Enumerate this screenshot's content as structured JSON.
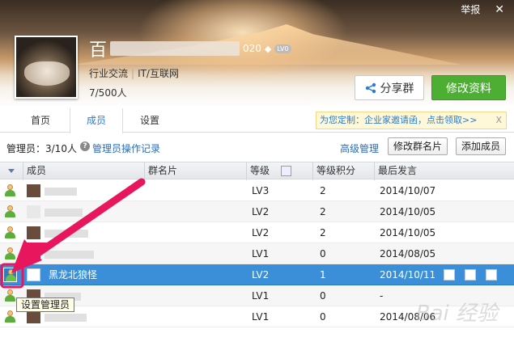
{
  "header": {
    "report_label": "举报",
    "close_glyph": "✕",
    "group_name_first_char": "百",
    "group_name_tail": "020",
    "level_badge": "LV0",
    "tags": [
      "行业交流",
      "IT/互联网"
    ],
    "member_count": "7/500人",
    "share_label": "分享群",
    "edit_label": "修改资料"
  },
  "tabs": [
    {
      "label": "首页",
      "active": false
    },
    {
      "label": "成员",
      "active": true
    },
    {
      "label": "设置",
      "active": false
    }
  ],
  "promo": {
    "text": "为您定制：企业家邀请函，点击领取>>",
    "close": "X"
  },
  "admin_bar": {
    "admin_count": "管理员：3/10人",
    "admin_log": "管理员操作记录",
    "advanced": "高级管理",
    "edit_card": "修改群名片",
    "add_member": "添加成员"
  },
  "table": {
    "columns": [
      "成员",
      "群名片",
      "等级",
      "等级积分",
      "最后发言"
    ],
    "rows": [
      {
        "name": "",
        "level": "LV3",
        "points": "2",
        "last": "2014/10/07",
        "selected": false
      },
      {
        "name": "",
        "level": "LV2",
        "points": "2",
        "last": "2014/10/05",
        "selected": false
      },
      {
        "name": "",
        "level": "LV2",
        "points": "2",
        "last": "2014/10/05",
        "selected": false
      },
      {
        "name": "",
        "level": "LV1",
        "points": "0",
        "last": "2014/08/05",
        "selected": false
      },
      {
        "name": "黑龙北狼怪",
        "level": "LV2",
        "points": "1",
        "last": "2014/10/11",
        "selected": true
      },
      {
        "name": "",
        "level": "LV1",
        "points": "0",
        "last": "-",
        "selected": false
      },
      {
        "name": "",
        "level": "LV1",
        "points": "0",
        "last": "2014/08/06",
        "selected": false
      }
    ]
  },
  "tooltip": "设置管理员",
  "watermark": "Bai 经验",
  "colors": {
    "accent": "#2b7bd2",
    "selected_row": "#3b8fd8",
    "edit_button": "#4cae32",
    "arrow": "#e8175d"
  }
}
